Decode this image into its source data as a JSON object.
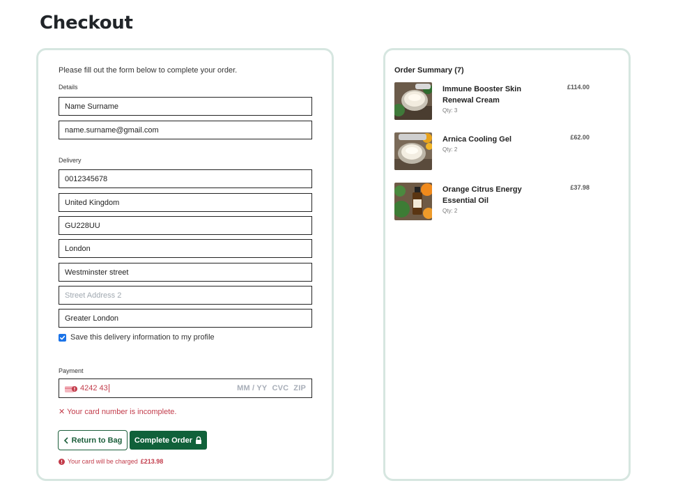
{
  "page": {
    "title": "Checkout"
  },
  "form": {
    "intro": "Please fill out the form below to complete your order.",
    "details_label": "Details",
    "name_value": "Name Surname",
    "email_value": "name.surname@gmail.com",
    "delivery_label": "Delivery",
    "phone_value": "0012345678",
    "country_value": "United Kingdom",
    "postcode_value": "GU228UU",
    "city_value": "London",
    "street1_value": "Westminster street",
    "street2_placeholder": "Street Address 2",
    "county_value": "Greater London",
    "save_label": "Save this delivery information to my profile",
    "save_checked": true,
    "payment_label": "Payment",
    "card_number": "4242 43",
    "card_expiry_placeholder": "MM / YY",
    "card_cvc_placeholder": "CVC",
    "card_zip_placeholder": "ZIP",
    "card_error": "Your card number is incomplete.",
    "return_button": "Return to Bag",
    "complete_button": "Complete Order",
    "charge_prefix": "Your card will be charged",
    "charge_amount": "£213.98"
  },
  "summary": {
    "title": "Order Summary (7)",
    "items": [
      {
        "name": "Immune Booster Skin Renewal Cream",
        "qty": "Qty: 3",
        "price": "£114.00",
        "image": "cream-jar-image"
      },
      {
        "name": "Arnica Cooling Gel",
        "qty": "Qty: 2",
        "price": "£62.00",
        "image": "gel-jar-image"
      },
      {
        "name": "Orange Citrus Energy Essential Oil",
        "qty": "Qty: 2",
        "price": "£37.98",
        "image": "oil-bottle-image"
      }
    ]
  },
  "colors": {
    "accent": "#10613a",
    "error": "#c23b4a",
    "panel_border": "#d6e6e0",
    "checkbox": "#1a73e8"
  }
}
